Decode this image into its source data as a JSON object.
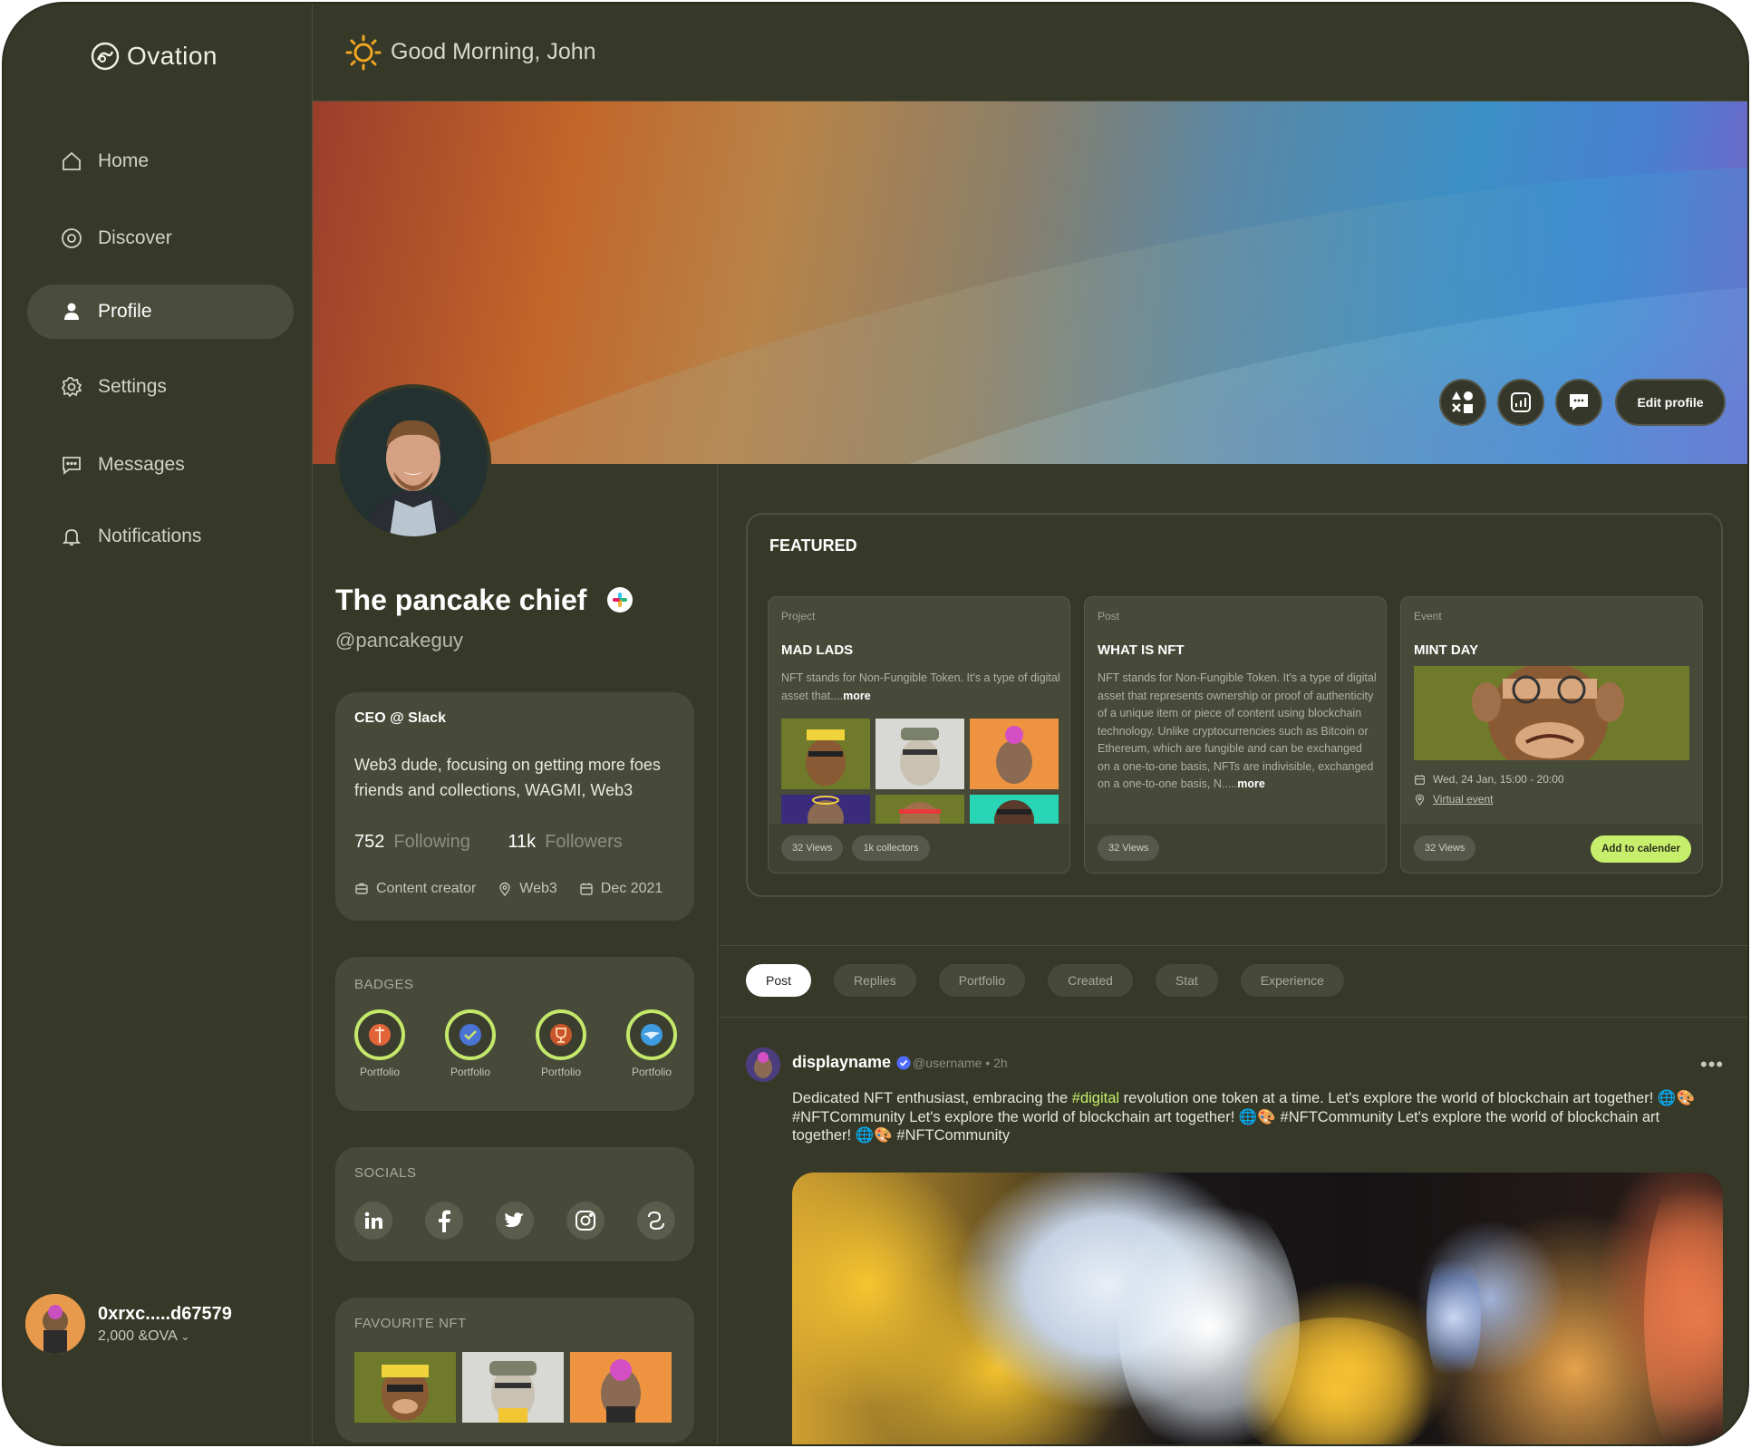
{
  "app": {
    "name": "Ovation"
  },
  "sidebar": {
    "items": [
      {
        "label": "Home",
        "icon": "home-icon"
      },
      {
        "label": "Discover",
        "icon": "compass-icon"
      },
      {
        "label": "Profile",
        "icon": "user-icon"
      },
      {
        "label": "Settings",
        "icon": "gear-icon"
      },
      {
        "label": "Messages",
        "icon": "chat-icon"
      },
      {
        "label": "Notifications",
        "icon": "bell-icon"
      }
    ],
    "wallet": {
      "address": "0xrxc.....d67579",
      "balance": "2,000 &OVA"
    }
  },
  "header": {
    "greeting": "Good Morning, John"
  },
  "banner": {
    "edit_label": "Edit profile"
  },
  "profile": {
    "name": "The pancake chief",
    "handle": "@pancakeguy",
    "role": "CEO @ Slack",
    "bio": "Web3 dude, focusing on getting more foes friends and collections, WAGMI, Web3",
    "following_count": "752",
    "following_label": "Following",
    "followers_count": "11k",
    "followers_label": "Followers",
    "occupation": "Content creator",
    "location": "Web3",
    "joined": "Dec 2021"
  },
  "badges": {
    "title": "BADGES",
    "items": [
      {
        "label": "Portfolio"
      },
      {
        "label": "Portfolio"
      },
      {
        "label": "Portfolio"
      },
      {
        "label": "Portfolio"
      }
    ]
  },
  "socials": {
    "title": "SOCIALS"
  },
  "favourite_nft": {
    "title": "FAVOURITE NFT"
  },
  "featured": {
    "title": "FEATURED",
    "cards": [
      {
        "type": "Project",
        "title": "MAD LADS",
        "desc": "NFT stands for Non-Fungible Token. It's a type of digital asset that....",
        "more": "more",
        "pills": [
          "32 Views",
          "1k collectors"
        ]
      },
      {
        "type": "Post",
        "title": "WHAT IS NFT",
        "desc": "NFT stands for Non-Fungible Token. It's a type of digital asset that represents ownership or proof of authenticity of a unique item or piece of content using blockchain technology. Unlike cryptocurrencies such as Bitcoin or Ethereum, which are fungible and can be exchanged on a one-to-one basis, NFTs are indivisible, exchanged on a one-to-one basis, N.....",
        "more": "more",
        "pills": [
          "32 Views"
        ]
      },
      {
        "type": "Event",
        "title": "MINT DAY",
        "date": "Wed, 24 Jan, 15:00 - 20:00",
        "venue": "Virtual event",
        "pills": [
          "32 Views"
        ],
        "cta": "Add to calender"
      }
    ]
  },
  "tabs": [
    "Post",
    "Replies",
    "Portfolio",
    "Created",
    "Stat",
    "Experience"
  ],
  "post": {
    "display_name": "displayname",
    "username": "@username",
    "time": "• 2h",
    "text_before": "Dedicated NFT enthusiast, embracing the ",
    "tag": "#digital",
    "text_after": " revolution one token at a time. Let's explore the world of blockchain art together! 🌐🎨 #NFTCommunity Let's explore the world of blockchain art together! 🌐🎨 #NFTCommunity Let's explore the world of blockchain art together! 🌐🎨 #NFTCommunity"
  },
  "colors": {
    "background": "#363927",
    "card": "#474a39",
    "accent": "#c7ef6b",
    "verified": "#4f6bff"
  }
}
